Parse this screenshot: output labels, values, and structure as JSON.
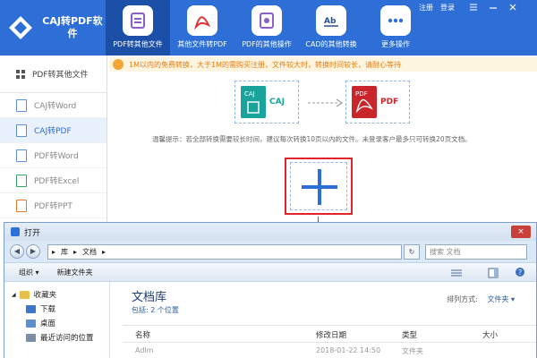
{
  "app": {
    "title": "CAJ转PDF软件",
    "window_controls": [
      "注册",
      "登录"
    ]
  },
  "nav": [
    {
      "label": "PDF转其他文件",
      "icon": "pdf-convert-icon",
      "active": true
    },
    {
      "label": "其他文件转PDF",
      "icon": "pdf-icon",
      "active": false
    },
    {
      "label": "PDF的其他操作",
      "icon": "pdf-tools-icon",
      "active": false
    },
    {
      "label": "CAD的其他转换",
      "icon": "cad-icon",
      "active": false
    },
    {
      "label": "更多操作",
      "icon": "more-icon",
      "active": false
    }
  ],
  "sidebar": {
    "heading": "PDF转其他文件",
    "items": [
      {
        "label": "CAJ转Word"
      },
      {
        "label": "CAJ转PDF",
        "active": true
      },
      {
        "label": "PDF转Word"
      },
      {
        "label": "PDF转Excel"
      },
      {
        "label": "PDF转PPT"
      }
    ]
  },
  "notice": "1M以内的免费转换，大于1M的需购买注册，文件较大时，转换时间较长，请耐心等待",
  "flow": {
    "from": "CAJ",
    "to": "PDF",
    "from_doc_label": "CAJ",
    "to_doc_label": "PDF"
  },
  "hint": "温馨提示：若全部转换需要较长时间，建议每次转换10页以内的文件。未登录客户最多只可转换20页文档。",
  "colors": {
    "brand_blue": "#2d6fd6",
    "highlight_red": "#e0262b",
    "caj_teal": "#1aa39a",
    "pdf_red": "#c8262b"
  },
  "dialog": {
    "title": "打开",
    "close_label": "×",
    "address": [
      "库",
      "文档"
    ],
    "search_placeholder": "搜索 文档",
    "toolbar": {
      "organize": "组织 ▾",
      "new_folder": "新建文件夹"
    },
    "tree": [
      "收藏夹",
      "下载",
      "桌面",
      "最近访问的位置"
    ],
    "library_title": "文档库",
    "library_sub": "包括: 2 个位置",
    "arrange_label": "排列方式:",
    "arrange_value": "文件夹 ▾",
    "columns": [
      "名称",
      "修改日期",
      "类型",
      "大小"
    ],
    "first_row": {
      "name": "Adlm",
      "date": "2018-01-22 14:50",
      "type": "文件夹"
    }
  }
}
